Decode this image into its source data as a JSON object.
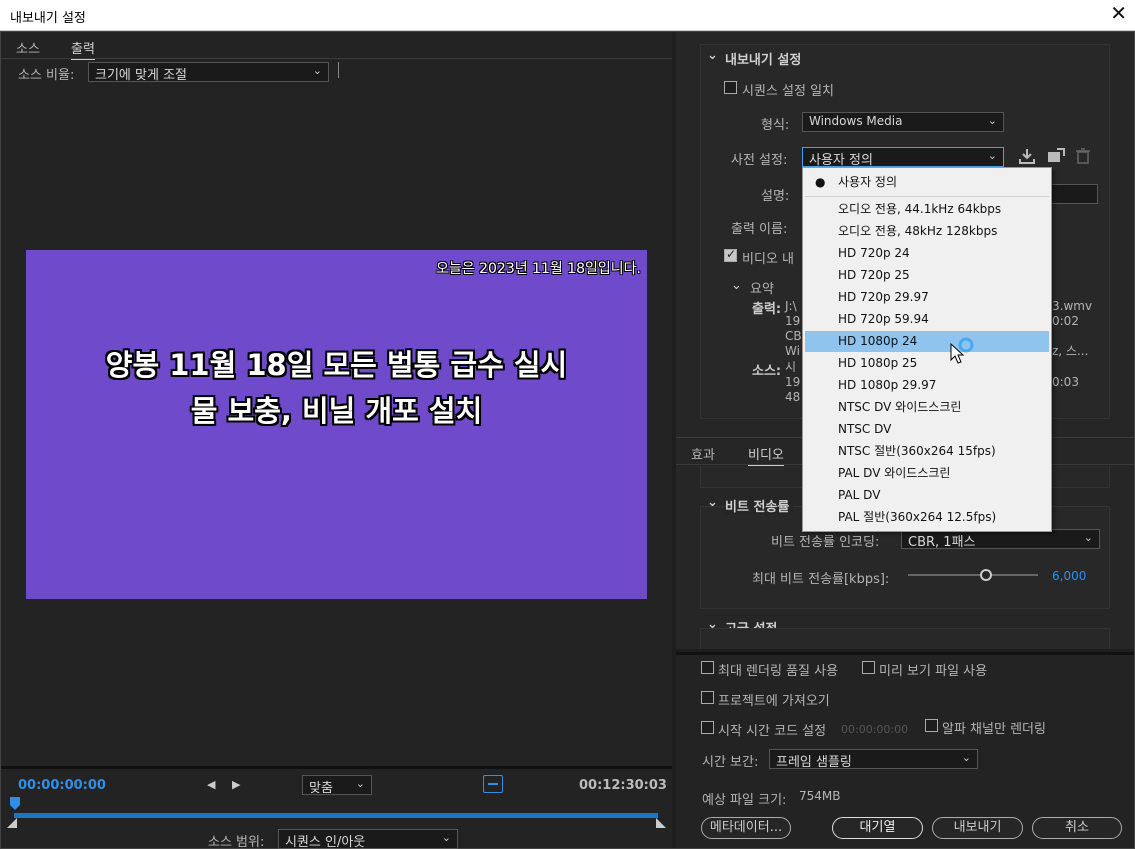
{
  "window": {
    "title": "내보내기 설정",
    "close": "✕"
  },
  "source_tabs": [
    "소스",
    "출력"
  ],
  "source_scaling": {
    "label": "소스 비율:",
    "value": "크기에 맞게 조절"
  },
  "preview": {
    "caption_top": "오늘은 2023년 11월 18일입니다.",
    "line1": "양봉  11월 18일 모든 벌통 급수 실시",
    "line2": "물 보충, 비닐 개포 설치",
    "bg_color": "#6f4acb"
  },
  "timeline": {
    "start": "00:00:00:00",
    "end": "00:12:30:03",
    "fit": "맞춤",
    "source_range_label": "소스 범위:",
    "source_range_value": "시퀀스 인/아웃"
  },
  "export_settings": {
    "section": "내보내기 설정",
    "match_sequence": "시퀀스 설정 일치",
    "format_label": "형식:",
    "format_value": "Windows Media",
    "preset_label": "사전 설정:",
    "preset_value": "사용자 정의",
    "comment_label": "설명:",
    "output_name_label": "출력 이름:",
    "export_video_partial": "비디오 내",
    "summary": "요약",
    "output_label": "출력:",
    "output_lines": [
      "J:\\",
      "19",
      "CB",
      "Wi"
    ],
    "output_right": [
      "3.wmv",
      "0:02",
      "z, 스..."
    ],
    "source_label": "소스:",
    "source_lines": [
      "시",
      "19",
      "48"
    ],
    "source_right": [
      "0:03"
    ]
  },
  "preset_menu": {
    "items": [
      "사용자 정의",
      "오디오 전용, 44.1kHz 64kbps",
      "오디오 전용, 48kHz 128kbps",
      "HD 720p 24",
      "HD 720p 25",
      "HD 720p 29.97",
      "HD 720p 59.94",
      "HD 1080p 24",
      "HD 1080p 25",
      "HD 1080p 29.97",
      "NTSC DV 와이드스크린",
      "NTSC DV",
      "NTSC 절반(360x264 15fps)",
      "PAL DV 와이드스크린",
      "PAL DV",
      "PAL 절반(360x264 12.5fps)"
    ],
    "checked": "사용자 정의",
    "highlighted": "HD 1080p 24"
  },
  "lower_tabs": [
    "효과",
    "비디오"
  ],
  "bitrate": {
    "section": "비트 전송률",
    "encoding_label": "비트 전송률 인코딩:",
    "encoding_value": "CBR, 1패스",
    "max_label": "최대 비트 전송률[kbps]:",
    "max_value": "6,000",
    "max_fraction": 0.6
  },
  "advanced": {
    "section": "고급 설정"
  },
  "options": {
    "max_render_quality": "최대 렌더링 품질 사용",
    "use_previews": "미리 보기 파일 사용",
    "import_into_project": "프로젝트에 가져오기",
    "set_start_timecode": "시작 시간 코드 설정",
    "timecode_value": "00:00:00:00",
    "alpha_only": "알파 채널만 렌더링",
    "time_interp_label": "시간 보간:",
    "time_interp_value": "프레임 샘플링",
    "est_size_label": "예상 파일 크기:",
    "est_size_value": "754MB"
  },
  "buttons": {
    "metadata": "메타데이터...",
    "queue": "대기열",
    "export": "내보내기",
    "cancel": "취소"
  },
  "colors": {
    "accent": "#2f8fe8",
    "menu_highlight": "#8ec4ee"
  }
}
